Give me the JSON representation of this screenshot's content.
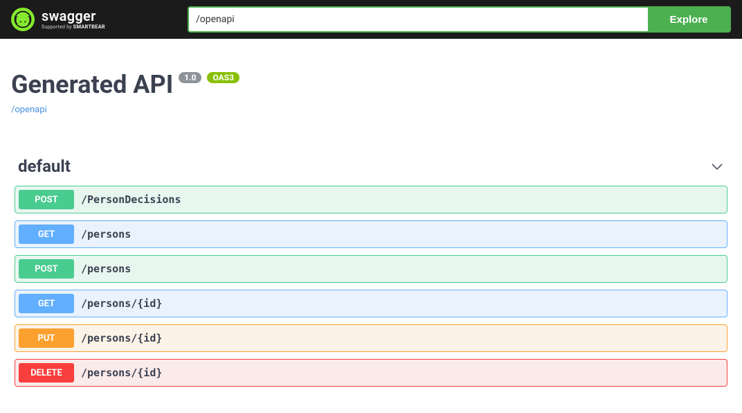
{
  "topbar": {
    "logo_main": "swagger",
    "logo_support": "Supported by SMARTBEAR",
    "spec_value": "/openapi",
    "explore_label": "Explore"
  },
  "header": {
    "title": "Generated API",
    "version": "1.0",
    "oas": "OAS3",
    "spec_link": "/openapi"
  },
  "section": {
    "name": "default"
  },
  "ops": [
    {
      "method": "POST",
      "path": "/PersonDecisions"
    },
    {
      "method": "GET",
      "path": "/persons"
    },
    {
      "method": "POST",
      "path": "/persons"
    },
    {
      "method": "GET",
      "path": "/persons/{id}"
    },
    {
      "method": "PUT",
      "path": "/persons/{id}"
    },
    {
      "method": "DELETE",
      "path": "/persons/{id}"
    }
  ]
}
